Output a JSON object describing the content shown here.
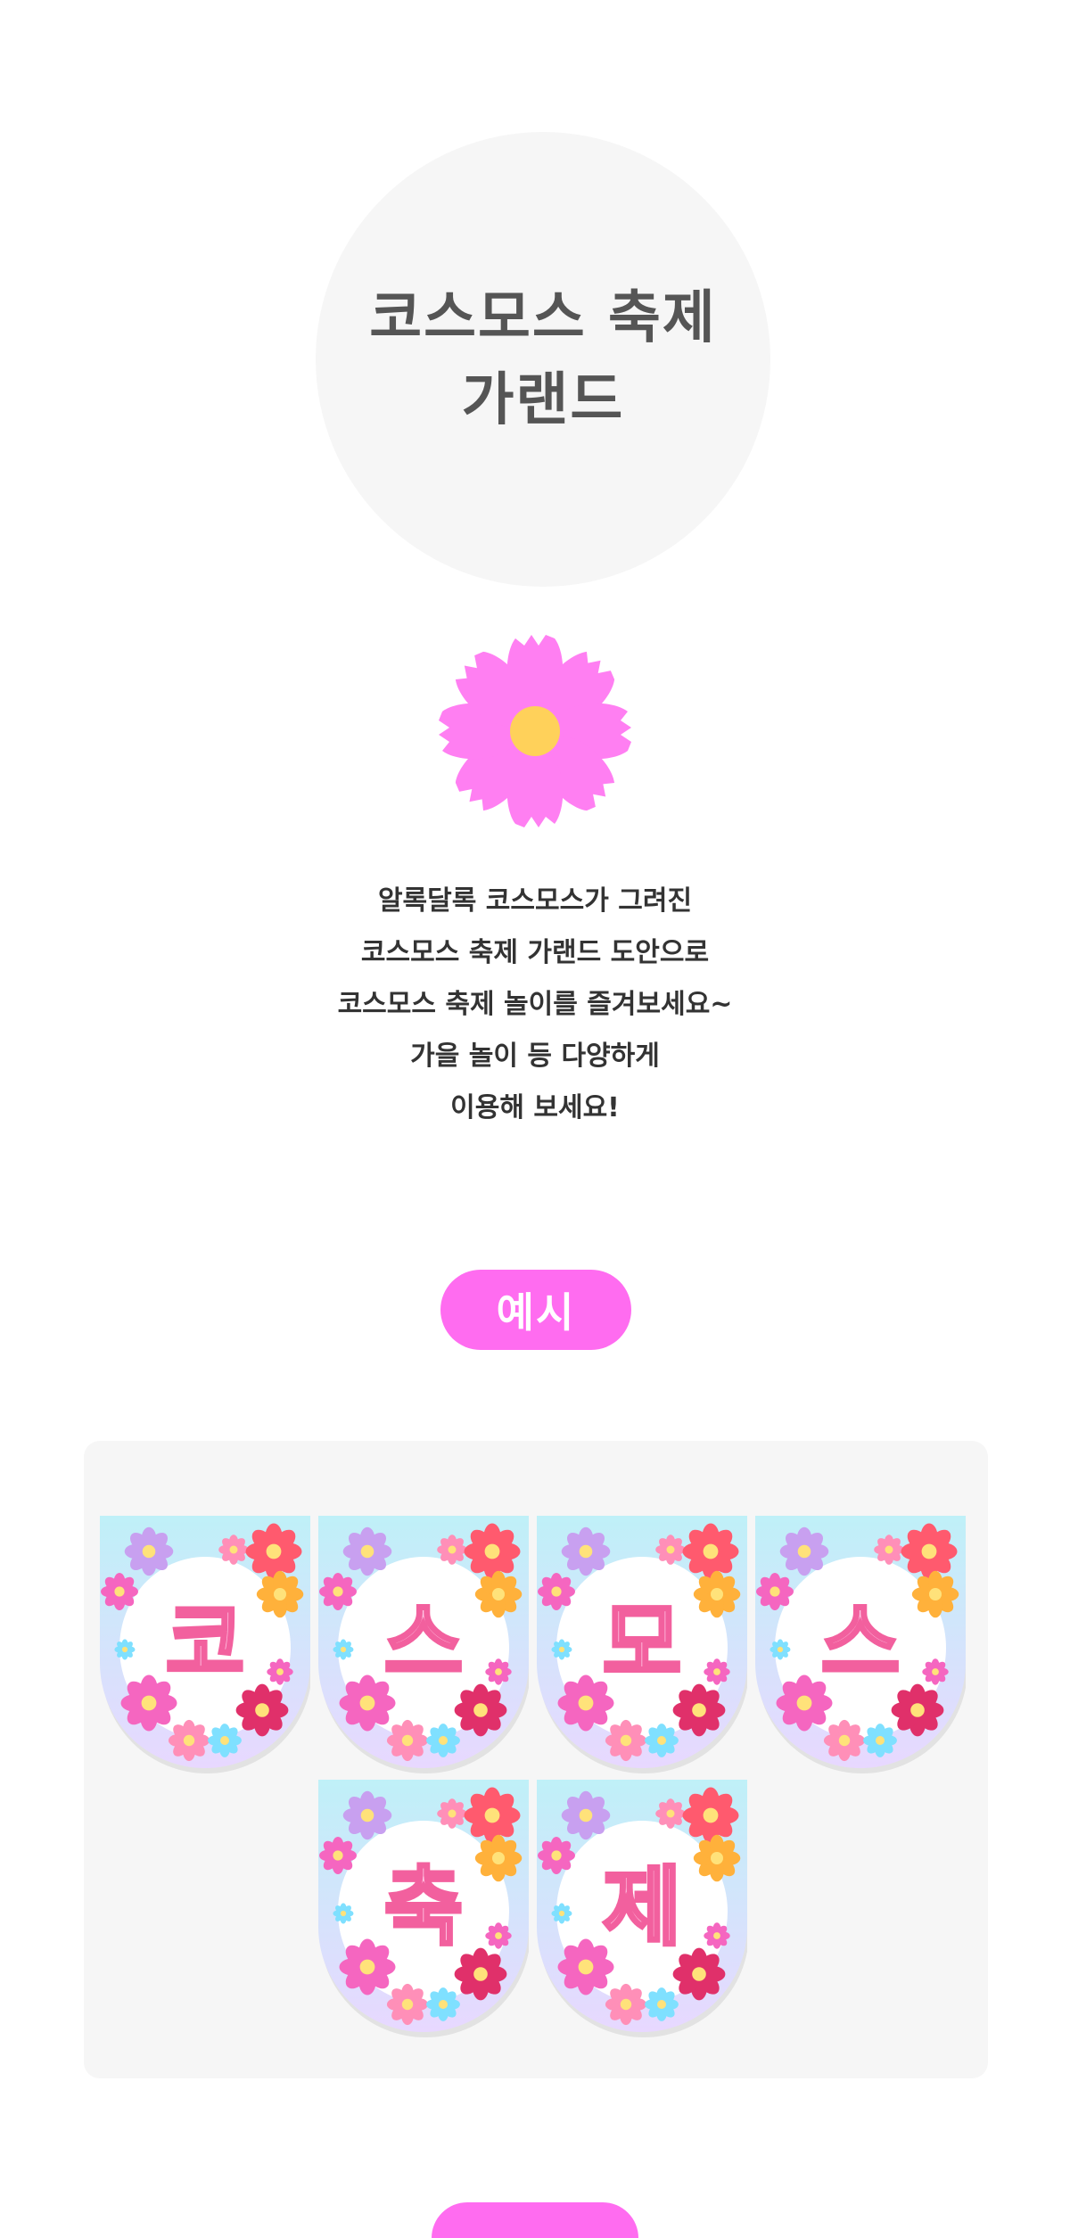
{
  "title": {
    "line1": "코스모스 축제",
    "line2": "가랜드"
  },
  "hero_icon": "cosmos-flower-icon",
  "description": [
    "알록달록 코스모스가 그려진",
    "코스모스 축제 가랜드 도안으로",
    "코스모스 축제 놀이를 즐겨보세요~",
    "가을 놀이 등 다양하게",
    "이용해 보세요!"
  ],
  "example_label": "예시",
  "banners": [
    "코",
    "스",
    "모",
    "스",
    "축",
    "제"
  ],
  "colors": {
    "accent": "#ff6cf0",
    "title": "#555555",
    "panel": "#f6f6f6",
    "flower": "#ff7ff2",
    "center": "#ffd15a"
  }
}
